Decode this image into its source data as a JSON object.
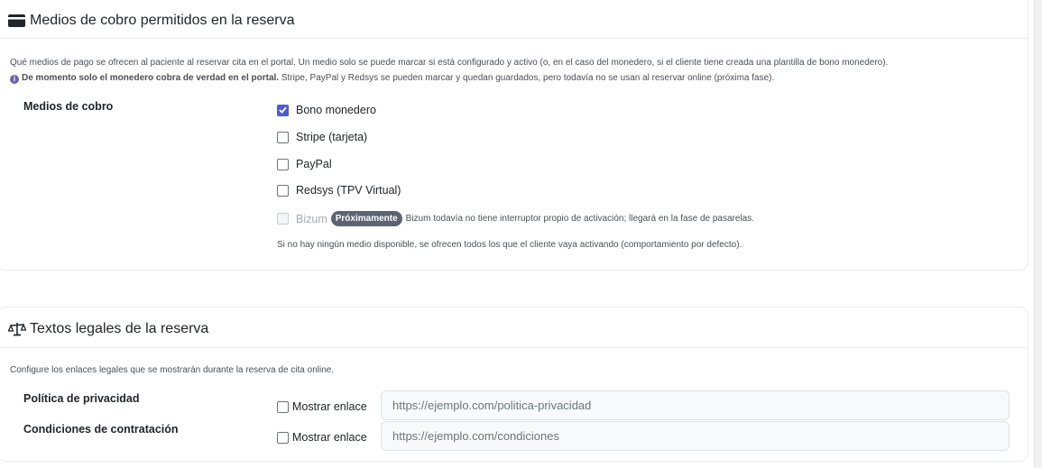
{
  "payment_card": {
    "title": "Medios de cobro permitidos en la reserva",
    "description": "Qué medios de pago se ofrecen al paciente al reservar cita en el portal. Un medio solo se puede marcar si está configurado y activo (o, en el caso del monedero, si el cliente tiene creada una plantilla de bono monedero).",
    "notice_bold": "De momento solo el monedero cobra de verdad en el portal.",
    "notice_rest": " Stripe, PayPal y Redsys se pueden marcar y quedan guardados, pero todavía no se usan al reservar online (próxima fase).",
    "field_label": "Medios de cobro",
    "methods": [
      {
        "label": "Bono monedero",
        "checked": true,
        "disabled": false
      },
      {
        "label": "Stripe (tarjeta)",
        "checked": false,
        "disabled": false
      },
      {
        "label": "PayPal",
        "checked": false,
        "disabled": false
      },
      {
        "label": "Redsys (TPV Virtual)",
        "checked": false,
        "disabled": false
      }
    ],
    "bizum": {
      "label": "Bizum",
      "badge": "Próximamente",
      "hint": "Bizum todavía no tiene interruptor propio de activación; llegará en la fase de pasarelas."
    },
    "default_note": "Si no hay ningún medio disponible, se ofrecen todos los que el cliente vaya activando (comportamiento por defecto)."
  },
  "legal_card": {
    "title": "Textos legales de la reserva",
    "description": "Configure los enlaces legales que se mostrarán durante la reserva de cita online.",
    "rows": [
      {
        "label": "Política de privacidad",
        "checkbox_label": "Mostrar enlace",
        "checked": false,
        "placeholder": "https://ejemplo.com/politica-privacidad"
      },
      {
        "label": "Condiciones de contratación",
        "checkbox_label": "Mostrar enlace",
        "checked": false,
        "placeholder": "https://ejemplo.com/condiciones"
      }
    ]
  },
  "colors": {
    "accent": "#4f5bd5",
    "badge": "#5b6470",
    "info": "#6c64b0"
  },
  "icons": {
    "payment_title": "credit-card-icon",
    "legal_title": "scale-balance-icon",
    "notice": "info-circle-icon"
  }
}
